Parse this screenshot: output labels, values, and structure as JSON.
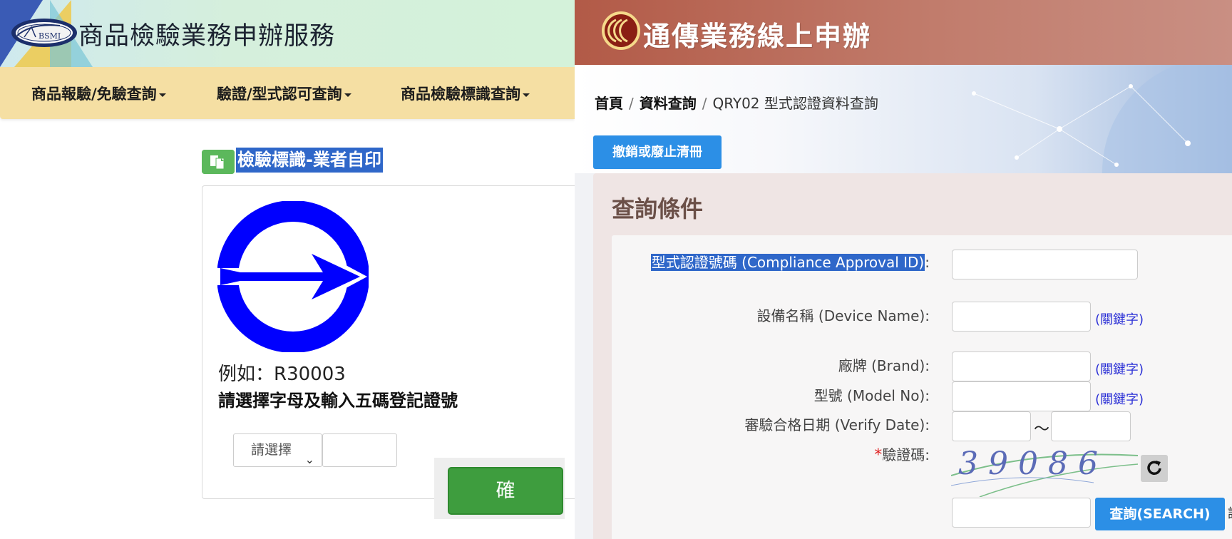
{
  "left_site": {
    "title": "商品檢驗業務申辦服務",
    "logo_text": "BSMI",
    "nav": [
      {
        "label": "商品報驗/免驗查詢"
      },
      {
        "label": "驗證/型式認可查詢"
      },
      {
        "label": "商品檢驗標識查詢"
      }
    ],
    "section_title": "檢驗標識-業者自印",
    "example": "例如：R30003",
    "instruction": "請選擇字母及輸入五碼登記證號",
    "select_value": "請選擇",
    "confirm_label": "確　　定"
  },
  "right_site": {
    "title": "通傳業務線上申辦",
    "breadcrumb": {
      "home": "首頁",
      "section": "資料查詢",
      "current": "QRY02 型式認證資料查詢"
    },
    "revoke_button": "撤銷或廢止清冊",
    "query_title": "查詢條件",
    "fields": {
      "approval_id": "型式認證號碼 (Compliance Approval ID)",
      "device_name": "設備名稱 (Device Name):",
      "brand": "廠牌 (Brand):",
      "model_no": "型號 (Model No):",
      "verify_date": "審驗合格日期 (Verify Date):",
      "captcha": "驗證碼:"
    },
    "colon": ":",
    "keyword_hint": "(關鍵字)",
    "date_separator": "～",
    "required_mark": "*",
    "captcha_text": "39086",
    "search_button": "查詢(SEARCH)",
    "edge_text": "請"
  },
  "colors": {
    "nav_bg": "#f5dfa3",
    "highlight": "#2f67c9",
    "confirm_green": "#3e9d3e",
    "ncc_header": "#b25a47",
    "action_blue": "#2c8fe6"
  }
}
